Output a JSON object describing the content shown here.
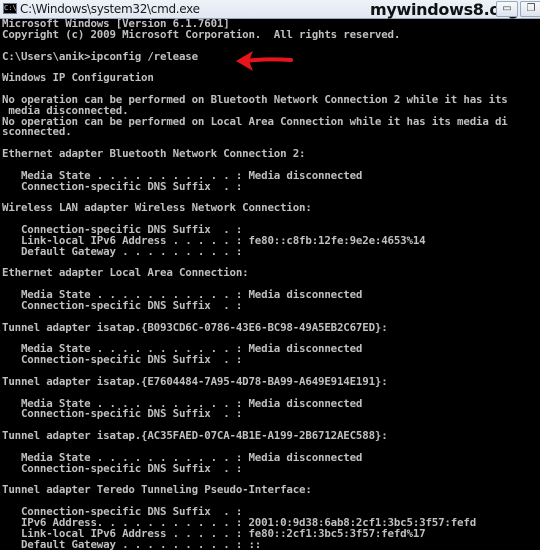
{
  "window": {
    "title": "C:\\Windows\\system32\\cmd.exe",
    "icon": "cmd-icon",
    "icon_glyph": "C:\\",
    "watermark": "mywindows8.org",
    "minimize_glyph": "▭",
    "maximize_glyph": "❐"
  },
  "annotation": {
    "icon": "red-arrow-icon",
    "color": "#e8141b",
    "points_to": "ipconfig /release"
  },
  "console": {
    "background": "#000000",
    "foreground": "#c0c0c0",
    "lines": [
      "Microsoft Windows [Version 6.1.7601]",
      "Copyright (c) 2009 Microsoft Corporation.  All rights reserved.",
      "",
      "C:\\Users\\anik>ipconfig /release",
      "",
      "Windows IP Configuration",
      "",
      "No operation can be performed on Bluetooth Network Connection 2 while it has its",
      " media disconnected.",
      "No operation can be performed on Local Area Connection while it has its media di",
      "sconnected.",
      "",
      "Ethernet adapter Bluetooth Network Connection 2:",
      "",
      "   Media State . . . . . . . . . . . : Media disconnected",
      "   Connection-specific DNS Suffix  . :",
      "",
      "Wireless LAN adapter Wireless Network Connection:",
      "",
      "   Connection-specific DNS Suffix  . :",
      "   Link-local IPv6 Address . . . . . : fe80::c8fb:12fe:9e2e:4653%14",
      "   Default Gateway . . . . . . . . . :",
      "",
      "Ethernet adapter Local Area Connection:",
      "",
      "   Media State . . . . . . . . . . . : Media disconnected",
      "   Connection-specific DNS Suffix  . :",
      "",
      "Tunnel adapter isatap.{B093CD6C-0786-43E6-BC98-49A5EB2C67ED}:",
      "",
      "   Media State . . . . . . . . . . . : Media disconnected",
      "   Connection-specific DNS Suffix  . :",
      "",
      "Tunnel adapter isatap.{E7604484-7A95-4D78-BA99-A649E914E191}:",
      "",
      "   Media State . . . . . . . . . . . : Media disconnected",
      "   Connection-specific DNS Suffix  . :",
      "",
      "Tunnel adapter isatap.{AC35FAED-07CA-4B1E-A199-2B6712AEC588}:",
      "",
      "   Media State . . . . . . . . . . . : Media disconnected",
      "   Connection-specific DNS Suffix  . :",
      "",
      "Tunnel adapter Teredo Tunneling Pseudo-Interface:",
      "",
      "   Connection-specific DNS Suffix  . :",
      "   IPv6 Address. . . . . . . . . . . : 2001:0:9d38:6ab8:2cf1:3bc5:3f57:fefd",
      "   Link-local IPv6 Address . . . . . : fe80::2cf1:3bc5:3f57:fefd%17",
      "   Default Gateway . . . . . . . . . : ::"
    ]
  }
}
